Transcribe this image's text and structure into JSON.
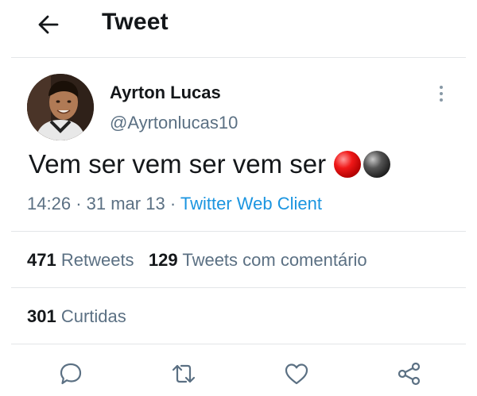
{
  "header": {
    "title": "Tweet"
  },
  "author": {
    "name": "Ayrton Lucas",
    "handle": "@Ayrtonlucas10"
  },
  "tweet": {
    "text": "Vem ser vem ser vem ser",
    "emojis": [
      "red-ball",
      "black-ball"
    ]
  },
  "meta": {
    "time": "14:26",
    "sep1": "·",
    "date": "31 mar 13",
    "sep2": "·",
    "client": "Twitter Web Client"
  },
  "stats": {
    "retweets_count": "471",
    "retweets_label": "Retweets",
    "quotes_count": "129",
    "quotes_label": "Tweets com comentário",
    "likes_count": "301",
    "likes_label": "Curtidas"
  },
  "actions": [
    "reply-icon",
    "retweet-icon",
    "like-icon",
    "share-icon"
  ],
  "colors": {
    "link": "#1b95e0",
    "secondary": "#5b7083",
    "divider": "#e3e6e8",
    "icon": "#5b7083"
  }
}
